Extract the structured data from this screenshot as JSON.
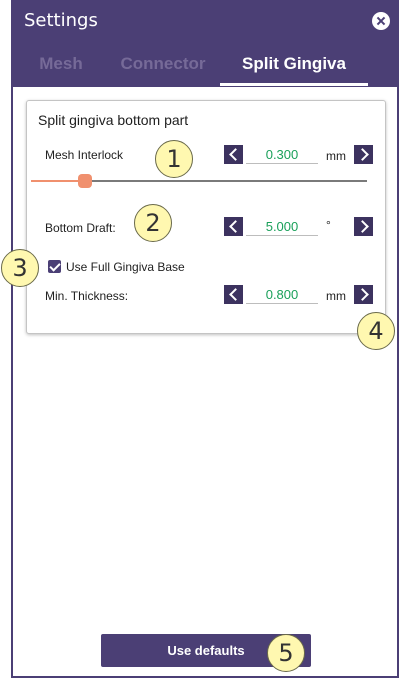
{
  "window": {
    "title": "Settings"
  },
  "tabs": [
    "Mesh",
    "Connector",
    "Split Gingiva"
  ],
  "panel": {
    "title": "Split gingiva bottom part",
    "mesh_interlock": {
      "label": "Mesh Interlock",
      "value": "0.300",
      "unit": "mm",
      "slider_fraction": 0.16
    },
    "bottom_draft": {
      "label": "Bottom Draft:",
      "value": "5.000",
      "unit": "°"
    },
    "use_full_base": {
      "label": "Use Full Gingiva Base",
      "checked": true
    },
    "min_thickness": {
      "label": "Min. Thickness:",
      "value": "0.800",
      "unit": "mm"
    }
  },
  "defaults_button": "Use defaults",
  "callouts": [
    "1",
    "2",
    "3",
    "4",
    "5"
  ],
  "colors": {
    "accent": "#4b3f75",
    "value_text": "#1aa05a",
    "slider": "#f0906e"
  }
}
